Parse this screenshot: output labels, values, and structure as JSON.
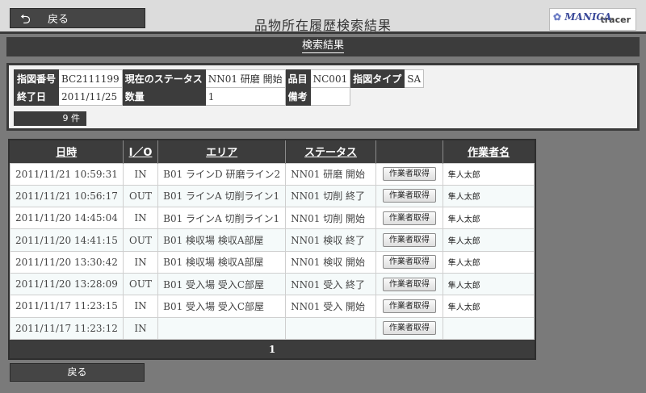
{
  "header": {
    "back_label": "戻る",
    "title": "品物所在履歴検索結果",
    "logo_mark": "MANICA",
    "logo_word": "tracer"
  },
  "section": {
    "title": "検索結果"
  },
  "info": {
    "order_no_label": "指図番号",
    "order_no": "BC2111199",
    "status_label": "現在のステータス",
    "status": "NN01 研磨 開始",
    "item_label": "品目",
    "item": "NC001",
    "type_label": "指図タイプ",
    "type": "SA",
    "end_date_label": "終了日",
    "end_date": "2011/11/25",
    "qty_label": "数量",
    "qty": "1",
    "remark_label": "備考",
    "remark": "",
    "count": "9 件"
  },
  "results": {
    "columns": [
      "日時",
      "I／O",
      "エリア",
      "ステータス",
      "",
      "作業者名"
    ],
    "button_label": "作業者取得",
    "rows": [
      {
        "datetime": "2011/11/21 10:59:31",
        "io": "IN",
        "area": "B01 ラインD 研磨ライン2",
        "status": "NN01 研磨 開始",
        "worker": "隼人太郎"
      },
      {
        "datetime": "2011/11/21 10:56:17",
        "io": "OUT",
        "area": "B01 ラインA 切削ライン1",
        "status": "NN01 切削 終了",
        "worker": "隼人太郎"
      },
      {
        "datetime": "2011/11/20 14:45:04",
        "io": "IN",
        "area": "B01 ラインA 切削ライン1",
        "status": "NN01 切削 開始",
        "worker": "隼人太郎"
      },
      {
        "datetime": "2011/11/20 14:41:15",
        "io": "OUT",
        "area": "B01 検収場 検収A部屋",
        "status": "NN01 検収 終了",
        "worker": "隼人太郎"
      },
      {
        "datetime": "2011/11/20 13:30:42",
        "io": "IN",
        "area": "B01 検収場 検収A部屋",
        "status": "NN01 検収 開始",
        "worker": "隼人太郎"
      },
      {
        "datetime": "2011/11/20 13:28:09",
        "io": "OUT",
        "area": "B01 受入場 受入C部屋",
        "status": "NN01 受入 終了",
        "worker": "隼人太郎"
      },
      {
        "datetime": "2011/11/17 11:23:15",
        "io": "IN",
        "area": "B01 受入場 受入C部屋",
        "status": "NN01 受入 開始",
        "worker": "隼人太郎"
      },
      {
        "datetime": "2011/11/17 11:23:12",
        "io": "IN",
        "area": "",
        "status": "",
        "worker": ""
      }
    ],
    "page": "1"
  },
  "footer": {
    "back_label": "戻る"
  }
}
